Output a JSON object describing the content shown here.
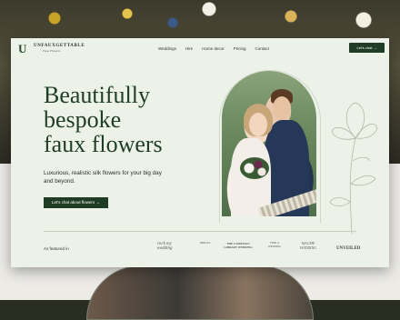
{
  "brand": {
    "name": "UNFAUXGETTABLE",
    "tagline": "Faux Flowers",
    "monogram": "U"
  },
  "nav": {
    "links": [
      "Weddings",
      "Hire",
      "Home decor",
      "Pricing",
      "Contact"
    ],
    "cta_label": "Let's chat →"
  },
  "hero": {
    "headline_line1": "Beautifully",
    "headline_line2": "bespoke",
    "headline_line3": "faux flowers",
    "subtext": "Luxurious, realistic silk flowers for your big day and beyond.",
    "cta_label": "Let's chat about flowers →"
  },
  "featured": {
    "label": "As featured in",
    "publications": [
      "rock my wedding",
      "BRIDAL",
      "THE CAMPAIGN LIBRARY WEDDING",
      "FIND A WEDDING",
      "MAGPIE WEDDING",
      "UNVEILED"
    ]
  },
  "colors": {
    "primary": "#1f3d24",
    "page_bg": "#edf2e9",
    "text": "#2b2b2b"
  }
}
